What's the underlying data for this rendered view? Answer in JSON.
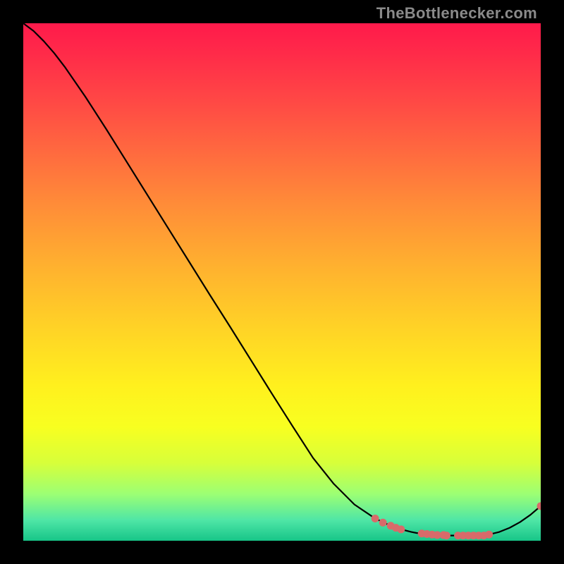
{
  "attribution": "TheBottlenecker.com",
  "colors": {
    "background": "#000000",
    "gradient_top": "#ff1a4b",
    "gradient_mid": "#fff01e",
    "gradient_bottom": "#17c588",
    "curve": "#000000",
    "dots": "#d86a6a"
  },
  "chart_data": {
    "type": "line",
    "title": "",
    "xlabel": "",
    "ylabel": "",
    "xlim": [
      0,
      100
    ],
    "ylim": [
      0,
      100
    ],
    "x": [
      0,
      2,
      4,
      6,
      8,
      12,
      16,
      20,
      24,
      28,
      32,
      36,
      40,
      44,
      48,
      52,
      56,
      60,
      64,
      68,
      71,
      73,
      75,
      76,
      78,
      80,
      82,
      84,
      86,
      88,
      90,
      92,
      94,
      96,
      98,
      100
    ],
    "y": [
      100,
      98.5,
      96.5,
      94.2,
      91.6,
      85.8,
      79.6,
      73.2,
      66.8,
      60.4,
      54.0,
      47.6,
      41.3,
      34.9,
      28.5,
      22.2,
      16.0,
      11.0,
      7.0,
      4.3,
      2.9,
      2.2,
      1.7,
      1.5,
      1.3,
      1.1,
      1.0,
      1.0,
      1.0,
      1.0,
      1.2,
      1.7,
      2.5,
      3.6,
      5.0,
      6.7
    ],
    "data_point_markers": [
      {
        "x": 68.0,
        "y": 4.3
      },
      {
        "x": 69.5,
        "y": 3.5
      },
      {
        "x": 71.0,
        "y": 2.9
      },
      {
        "x": 72.0,
        "y": 2.5
      },
      {
        "x": 73.0,
        "y": 2.2
      },
      {
        "x": 77.0,
        "y": 1.4
      },
      {
        "x": 78.0,
        "y": 1.3
      },
      {
        "x": 79.0,
        "y": 1.2
      },
      {
        "x": 80.0,
        "y": 1.1
      },
      {
        "x": 81.2,
        "y": 1.1
      },
      {
        "x": 81.8,
        "y": 1.0
      },
      {
        "x": 84.0,
        "y": 1.0
      },
      {
        "x": 85.0,
        "y": 1.0
      },
      {
        "x": 86.0,
        "y": 1.0
      },
      {
        "x": 87.0,
        "y": 1.0
      },
      {
        "x": 88.0,
        "y": 1.0
      },
      {
        "x": 89.0,
        "y": 1.0
      },
      {
        "x": 90.0,
        "y": 1.2
      },
      {
        "x": 100.0,
        "y": 6.7
      }
    ]
  }
}
